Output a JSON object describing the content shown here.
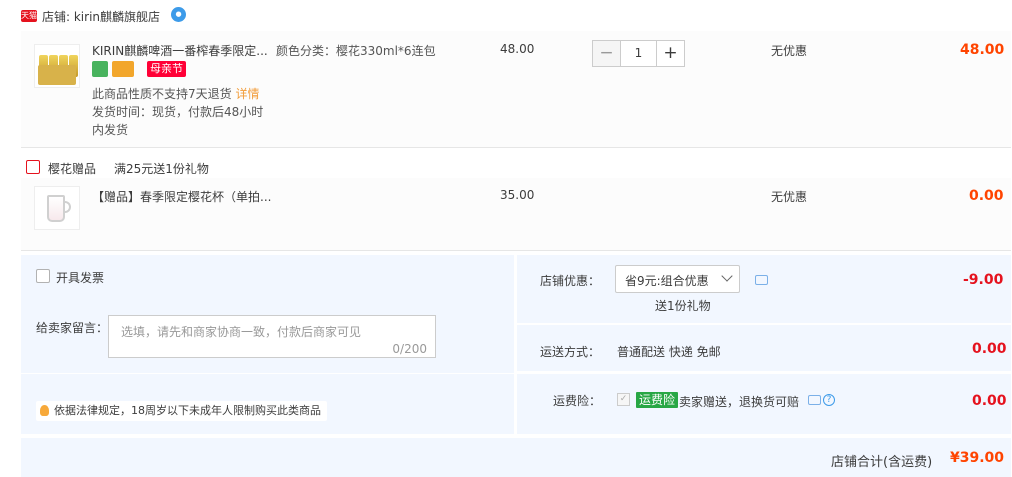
{
  "store": {
    "tmall_badge": "天猫",
    "label": "店铺: kirin麒麟旗舰店"
  },
  "item1": {
    "title": "KIRIN麒麟啤酒一番榨春季限定...",
    "sku": "颜色分类：樱花330ml*6连包",
    "badge_festival": "母亲节",
    "notice": "此商品性质不支持7天退货",
    "notice_link": "详情",
    "ship_line1": "发货时间：现货，付款后48小时",
    "ship_line2": "内发货",
    "price": "48.00",
    "quantity": "1",
    "minus": "−",
    "plus": "+",
    "promo": "无优惠",
    "total": "48.00"
  },
  "gift": {
    "name": "樱花赠品",
    "rule": "满25元送1份礼物"
  },
  "item2": {
    "title": "【赠品】春季限定樱花杯（单拍...",
    "price": "35.00",
    "promo": "无优惠",
    "total": "0.00"
  },
  "options": {
    "invoice_label": "开具发票",
    "message_label": "给卖家留言：",
    "message_placeholder": "选填，请先和商家协商一致，付款后商家可见",
    "message_count": "0/200",
    "law_notice": "依据法律规定，18周岁以下未成年人限制购买此类商品",
    "store_discount_label": "店铺优惠：",
    "store_discount_selected": "省9元:组合优惠",
    "store_discount_sub": "送1份礼物",
    "store_discount_value": "-9.00",
    "shipping_label": "运送方式：",
    "shipping_value": "普通配送 快递 免邮",
    "shipping_fee": "0.00",
    "insurance_label": "运费险：",
    "insurance_badge": "运费险",
    "insurance_text": "卖家赠送，退换货可赔",
    "insurance_fee": "0.00",
    "help_glyph": "?"
  },
  "summary": {
    "label": "店铺合计(含运费)",
    "value": "¥39.00"
  }
}
